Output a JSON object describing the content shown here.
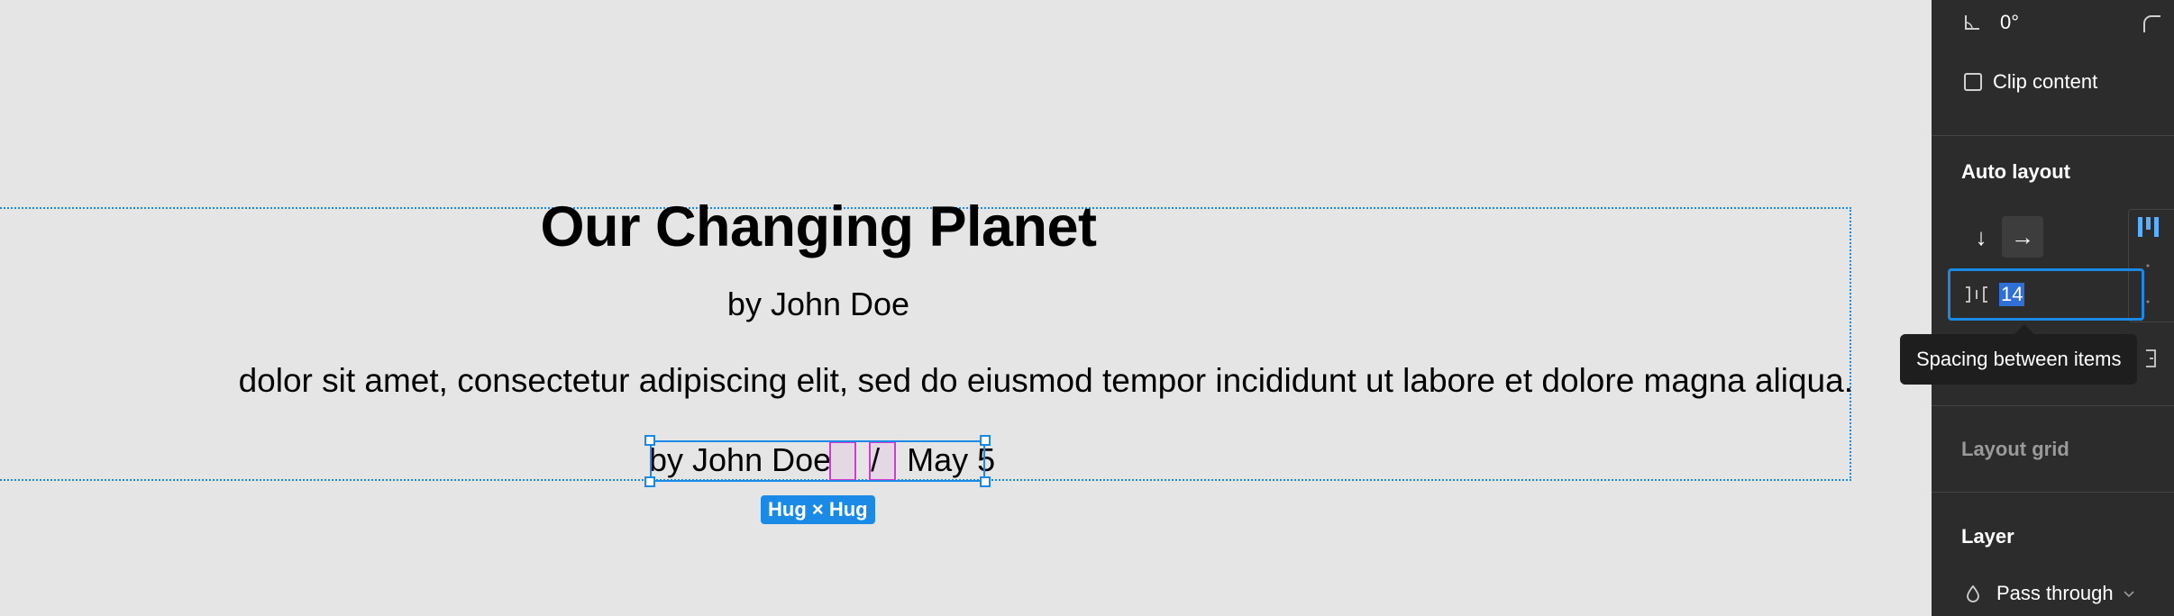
{
  "canvas": {
    "title": "Our Changing Planet",
    "byline": "by John Doe",
    "body_text": "dolor sit amet, consectetur adipiscing elit, sed do eiusmod tempor incididunt ut labore et dolore magna aliqua.",
    "meta": {
      "author": "by John Doe",
      "separator": "/",
      "date": "May 5"
    },
    "size_badge": "Hug × Hug"
  },
  "panel": {
    "rotation_value": "0°",
    "clip_content_label": "Clip content",
    "clip_content_checked": false,
    "auto_layout": {
      "title": "Auto layout",
      "direction_vertical_icon": "arrow-down-icon",
      "direction_horizontal_icon": "arrow-right-icon",
      "selected_direction": "horizontal",
      "spacing_value": "14",
      "spacing_tooltip": "Spacing between items"
    },
    "layout_grid_title": "Layout grid",
    "layer": {
      "title": "Layer",
      "blend_mode": "Pass through"
    }
  },
  "colors": {
    "selection": "#1b8ae6",
    "gap_highlight": "#d23ad2",
    "panel_bg": "#2c2c2c",
    "canvas_bg": "#e5e5e5"
  }
}
